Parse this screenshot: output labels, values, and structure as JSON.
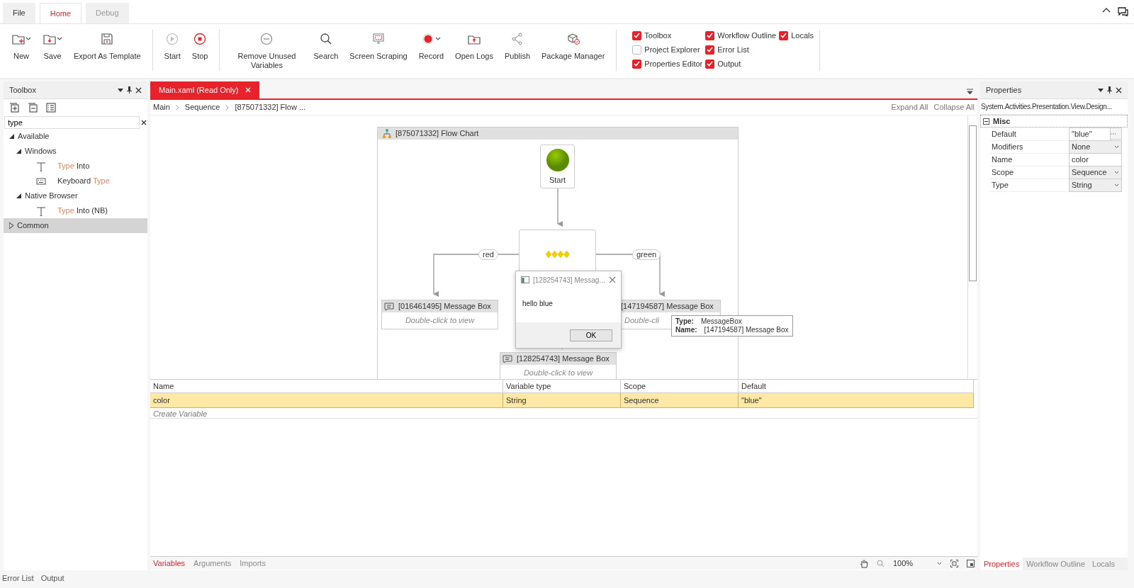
{
  "menu_tabs": [
    {
      "label": "File",
      "selected": false
    },
    {
      "label": "Home",
      "selected": true
    },
    {
      "label": "Debug",
      "selected": false
    }
  ],
  "ribbon_groups": [
    {
      "buttons": [
        {
          "label": "New",
          "dropdown": true
        },
        {
          "label": "Save",
          "dropdown": true
        },
        {
          "label": "Export As Template",
          "dropdown": false
        }
      ]
    },
    {
      "buttons": [
        {
          "label": "Start",
          "dropdown": false
        },
        {
          "label": "Stop",
          "dropdown": false
        }
      ]
    },
    {
      "buttons": [
        {
          "label": "Remove Unused Variables",
          "dropdown": false
        },
        {
          "label": "Search",
          "dropdown": false
        },
        {
          "label": "Screen Scraping",
          "dropdown": false
        },
        {
          "label": "Record",
          "dropdown": true
        },
        {
          "label": "Open Logs",
          "dropdown": false
        },
        {
          "label": "Publish",
          "dropdown": false
        },
        {
          "label": "Package Manager",
          "dropdown": false
        }
      ]
    }
  ],
  "view_panel_columns": [
    [
      {
        "label": "Toolbox",
        "checked": true
      },
      {
        "label": "Project Explorer",
        "checked": false
      },
      {
        "label": "Properties Editor",
        "checked": true
      }
    ],
    [
      {
        "label": "Workflow Outline",
        "checked": true
      },
      {
        "label": "Error List",
        "checked": true
      },
      {
        "label": "Output",
        "checked": true
      }
    ],
    [
      {
        "label": "Locals",
        "checked": true
      }
    ]
  ],
  "toolbox": {
    "title": "Toolbox",
    "search_value": "type",
    "tree": [
      {
        "parts": [
          {
            "text": "Available",
            "match": false
          }
        ],
        "expanded": true,
        "selected": false,
        "children": [
          {
            "parts": [
              {
                "text": "Windows",
                "match": false
              }
            ],
            "expanded": true,
            "selected": false,
            "children": [
              {
                "kind": "text",
                "parts": [
                  {
                    "text": "Type",
                    "match": true
                  },
                  {
                    "text": " Into",
                    "match": false
                  }
                ],
                "selected": false
              },
              {
                "kind": "keyboard",
                "parts": [
                  {
                    "text": "Keyboard ",
                    "match": false
                  },
                  {
                    "text": "Type",
                    "match": true
                  }
                ],
                "selected": false
              }
            ]
          },
          {
            "parts": [
              {
                "text": "Native Browser",
                "match": false
              }
            ],
            "expanded": true,
            "selected": false,
            "children": [
              {
                "kind": "text",
                "parts": [
                  {
                    "text": "Type",
                    "match": true
                  },
                  {
                    "text": " Into (NB)",
                    "match": false
                  }
                ],
                "selected": false
              }
            ]
          }
        ]
      },
      {
        "parts": [
          {
            "text": "Common",
            "match": false
          }
        ],
        "expanded": false,
        "selected": true
      }
    ]
  },
  "document": {
    "tab": {
      "label": "Main.xaml (Read Only)",
      "selected": true
    },
    "breadcrumb": [
      "Main",
      "Sequence",
      "[875071332] Flow ..."
    ],
    "expand_all": "Expand All",
    "collapse_all": "Collapse All",
    "flowchart": {
      "title": "[875071332] Flow Chart",
      "start": "Start",
      "edge_labels": [
        "red",
        "green"
      ],
      "message_boxes": [
        {
          "title": "[016461495] Message Box",
          "body": "Double-click to view"
        },
        {
          "title": "[147194587] Message Box",
          "body": "Double-cli"
        },
        {
          "title": "[128254743] Message Box",
          "body": "Double-click to view"
        }
      ],
      "dialog": {
        "title": "[128254743] Messag...",
        "message": "hello blue",
        "button": "OK"
      },
      "tooltip": {
        "type_label": "Type:",
        "type": "MessageBox",
        "name_label": "Name:",
        "name": "[147194587] Message Box"
      }
    }
  },
  "variables": {
    "columns": [
      "Name",
      "Variable type",
      "Scope",
      "Default"
    ],
    "rows": [
      {
        "cells": [
          "color",
          "String",
          "Sequence",
          "\"blue\""
        ],
        "selected": true
      }
    ],
    "create": "Create Variable",
    "tabs": [
      {
        "label": "Variables",
        "selected": true
      },
      {
        "label": "Arguments",
        "selected": false
      },
      {
        "label": "Imports",
        "selected": false
      }
    ],
    "zoom": "100%"
  },
  "properties": {
    "title": "Properties",
    "subtitle": "System.Activities.Presentation.View.Design...",
    "category": {
      "label": "Misc",
      "expanded": true
    },
    "rows": [
      {
        "label": "Default",
        "value": "\"blue\"",
        "kind": "ellipsis"
      },
      {
        "label": "Modifiers",
        "value": "None",
        "kind": "dropdown"
      },
      {
        "label": "Name",
        "value": "color",
        "kind": "text"
      },
      {
        "label": "Scope",
        "value": "Sequence",
        "kind": "dropdown"
      },
      {
        "label": "Type",
        "value": "String",
        "kind": "dropdown"
      }
    ],
    "tabs": [
      {
        "label": "Properties",
        "selected": true
      },
      {
        "label": "Workflow Outline",
        "selected": false
      },
      {
        "label": "Locals",
        "selected": false
      }
    ]
  },
  "status_bar": [
    "Error List",
    "Output"
  ]
}
